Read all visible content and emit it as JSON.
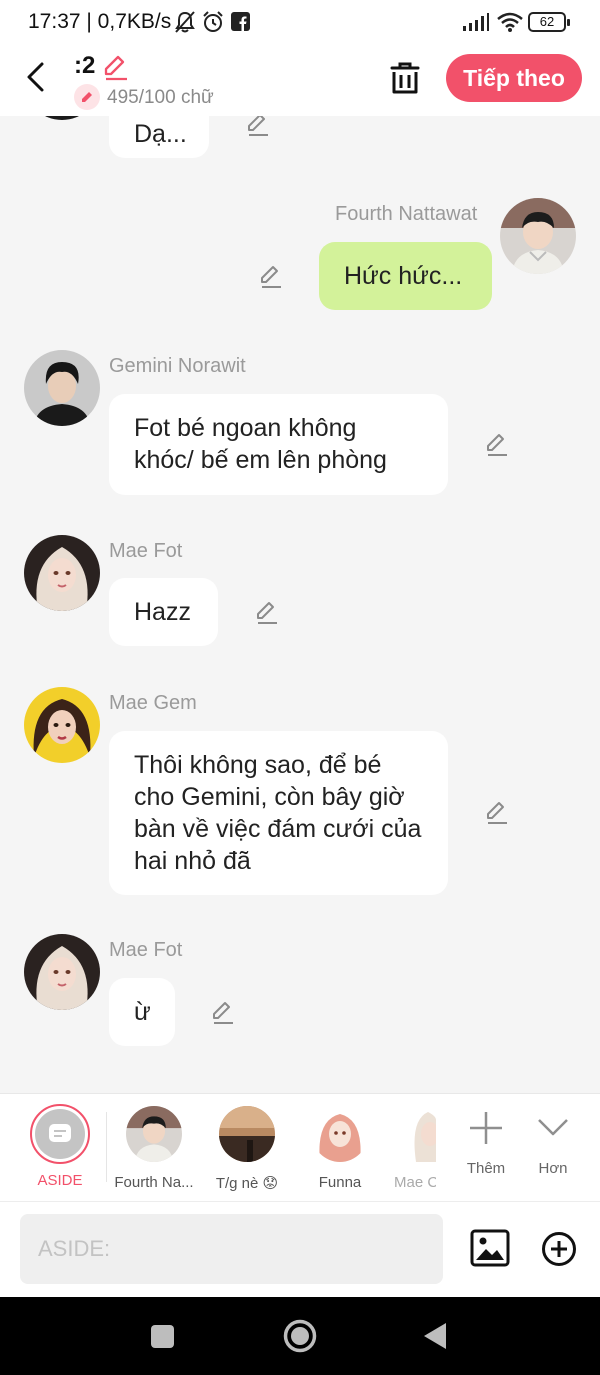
{
  "status": {
    "time": "17:37 | 0,7KB/s",
    "battery": "62"
  },
  "header": {
    "title": ":2",
    "word_count": "495/100 chữ",
    "next_label": "Tiếp theo"
  },
  "messages": [
    {
      "id": "m0",
      "side": "left",
      "name": "",
      "text": "Dạ..."
    },
    {
      "id": "m1",
      "side": "right",
      "name": "Fourth Nattawat",
      "text": "Hức hức..."
    },
    {
      "id": "m2",
      "side": "left",
      "name": "Gemini Norawit",
      "text": "Fot bé ngoan không khóc/ bế em lên phòng"
    },
    {
      "id": "m3",
      "side": "left",
      "name": "Mae Fot",
      "text": "Hazz"
    },
    {
      "id": "m4",
      "side": "left",
      "name": "Mae Gem",
      "text": "Thôi không sao, để bé cho Gemini, còn bây giờ bàn về việc đám cưới của hai nhỏ đã"
    },
    {
      "id": "m5",
      "side": "left",
      "name": "Mae Fot",
      "text": "ừ"
    }
  ],
  "characters": [
    {
      "label": "ASIDE",
      "selected": true
    },
    {
      "label": "Fourth Na..."
    },
    {
      "label": "T/g nè 😟"
    },
    {
      "label": "Funna"
    },
    {
      "label": "Mae C"
    }
  ],
  "actions": {
    "more_label": "Thêm",
    "collapse_label": "Hơn"
  },
  "input": {
    "placeholder": "ASIDE:"
  },
  "colors": {
    "accent": "#f2516a",
    "my_bubble": "#d3f29a",
    "background": "#f5f5f5"
  }
}
